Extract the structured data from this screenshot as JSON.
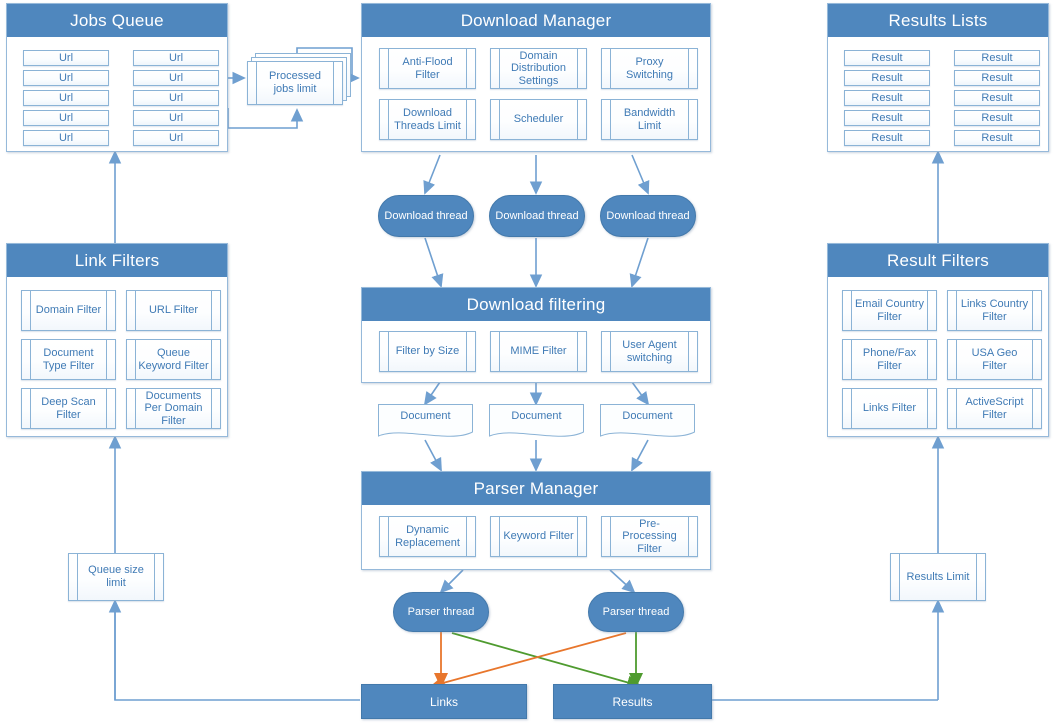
{
  "diagram": {
    "title": "Web crawler / download pipeline architecture",
    "colors": {
      "header_blue": "#4f87be",
      "box_border": "#8bb3d6",
      "text_blue": "#3f7ab5",
      "connector_blue": "#6f9fd0",
      "links_arrow_orange": "#e8762c",
      "results_arrow_green": "#4f9b2f"
    }
  },
  "panels": {
    "jobs_queue": {
      "title": "Jobs Queue",
      "left_column": [
        "Url",
        "Url",
        "Url",
        "Url",
        "Url"
      ],
      "right_column": [
        "Url",
        "Url",
        "Url",
        "Url",
        "Url"
      ]
    },
    "download_manager": {
      "title": "Download Manager",
      "items": [
        "Anti-Flood Filter",
        "Domain Distribution Settings",
        "Proxy Switching",
        "Download Threads Limit",
        "Scheduler",
        "Bandwidth Limit"
      ]
    },
    "results_lists": {
      "title": "Results Lists",
      "left_column": [
        "Result",
        "Result",
        "Result",
        "Result",
        "Result"
      ],
      "right_column": [
        "Result",
        "Result",
        "Result",
        "Result",
        "Result"
      ]
    },
    "link_filters": {
      "title": "Link Filters",
      "items": [
        "Domain Filter",
        "URL Filter",
        "Document Type Filter",
        "Queue Keyword Filter",
        "Deep Scan Filter",
        "Documents Per Domain Filter"
      ]
    },
    "result_filters": {
      "title": "Result Filters",
      "items": [
        "Email Country Filter",
        "Links Country Filter",
        "Phone/Fax Filter",
        "USA Geo Filter",
        "Links Filter",
        "ActiveScript Filter"
      ]
    },
    "download_filtering": {
      "title": "Download filtering",
      "items": [
        "Filter by Size",
        "MIME Filter",
        "User Agent switching"
      ]
    },
    "parser_manager": {
      "title": "Parser Manager",
      "items": [
        "Dynamic Replacement",
        "Keyword Filter",
        "Pre-Processing Filter"
      ]
    }
  },
  "nodes": {
    "processed_jobs_limit": "Processed jobs limit",
    "queue_size_limit": "Queue size limit",
    "results_limit": "Results Limit",
    "download_threads": [
      "Download thread",
      "Download thread",
      "Download thread"
    ],
    "documents": [
      "Document",
      "Document",
      "Document"
    ],
    "parser_threads": [
      "Parser thread",
      "Parser thread"
    ],
    "links": "Links",
    "results": "Results"
  }
}
